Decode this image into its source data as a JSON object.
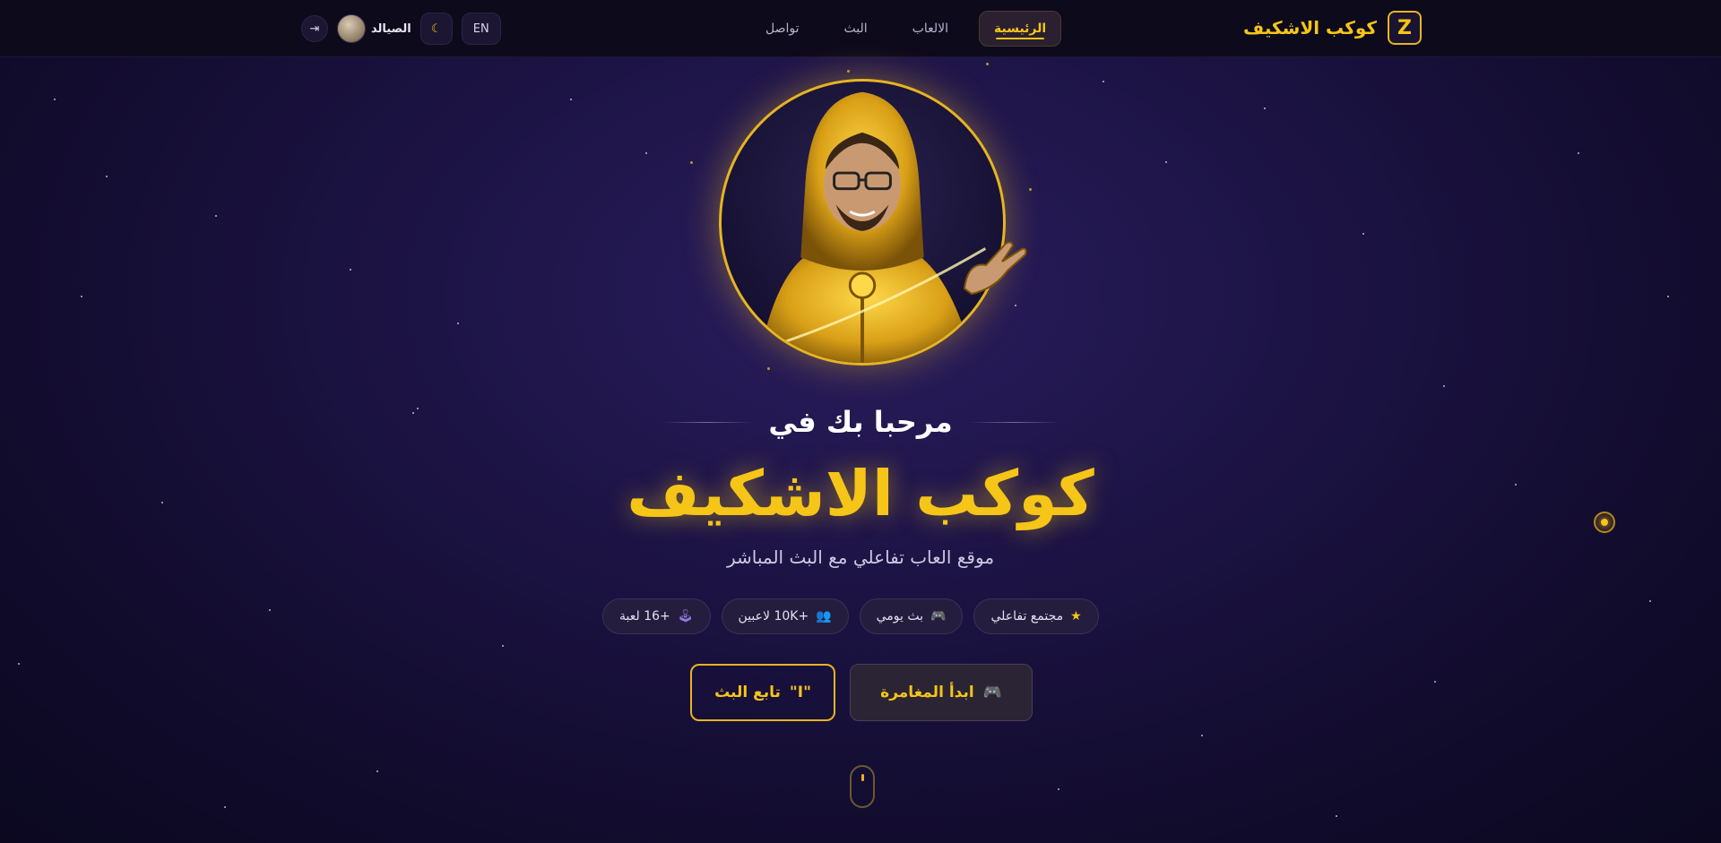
{
  "brand": {
    "name": "كوكب الاشكيف",
    "logo_glyph": "Z"
  },
  "nav": {
    "items": [
      {
        "label": "الرئيسية",
        "active": true
      },
      {
        "label": "الالعاب",
        "active": false
      },
      {
        "label": "البث",
        "active": false
      },
      {
        "label": "تواصل",
        "active": false
      }
    ]
  },
  "tools": {
    "language": "EN",
    "theme_icon": "moon-icon",
    "user_name": "الصيالد",
    "logout_icon": "logout-icon"
  },
  "hero": {
    "welcome": "مرحبا بك في",
    "title": "كوكب الاشكيف",
    "subtitle": "موقع العاب تفاعلي مع البث المباشر"
  },
  "badges": [
    {
      "label": "مجتمع تفاعلي",
      "icon": "star-icon"
    },
    {
      "label": "بث يومي",
      "icon": "gamepad-icon"
    },
    {
      "label": "+10K لاعبين",
      "icon": "users-icon"
    },
    {
      "label": "+16 لعبة",
      "icon": "joystick-icon"
    }
  ],
  "ctas": {
    "primary_label": "ابدأ المغامرة",
    "primary_icon": "gamepad-icon",
    "secondary_label": "تابع البث",
    "secondary_icon": "quote-icon"
  },
  "colors": {
    "accent": "#f5c518",
    "background": "#1d1446",
    "header": "#0d0a1c"
  }
}
